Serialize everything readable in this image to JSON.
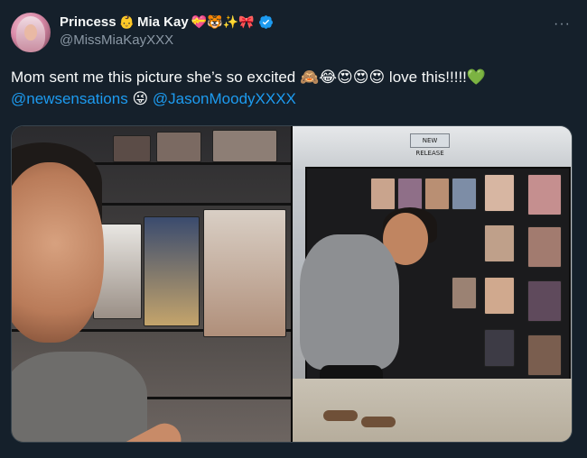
{
  "author": {
    "display_name": "Princess",
    "display_name_2": "Mia Kay",
    "name_emojis_1": "👶",
    "name_emojis_2": "💝🐯✨🎀",
    "handle": "@MissMiaKayXXX",
    "verified": true
  },
  "more_label": "···",
  "tweet": {
    "text_part_1": "Mom sent me this picture she’s so excited ",
    "emojis_1": "🙈😂😍😍😍",
    "text_part_2": " love this!!!!!",
    "emoji_heart": "💚",
    "mention_1": "@newsensations",
    "emoji_2": " 😜 ",
    "mention_2": "@JasonMoodyXXXX"
  },
  "media": {
    "sign_text": "NEW RELEASE"
  },
  "colors": {
    "background": "#15202b",
    "text": "#f7f9f9",
    "secondary_text": "#8b98a5",
    "link": "#1d9bf0",
    "border": "#38444d",
    "verified_badge": "#1d9bf0"
  }
}
